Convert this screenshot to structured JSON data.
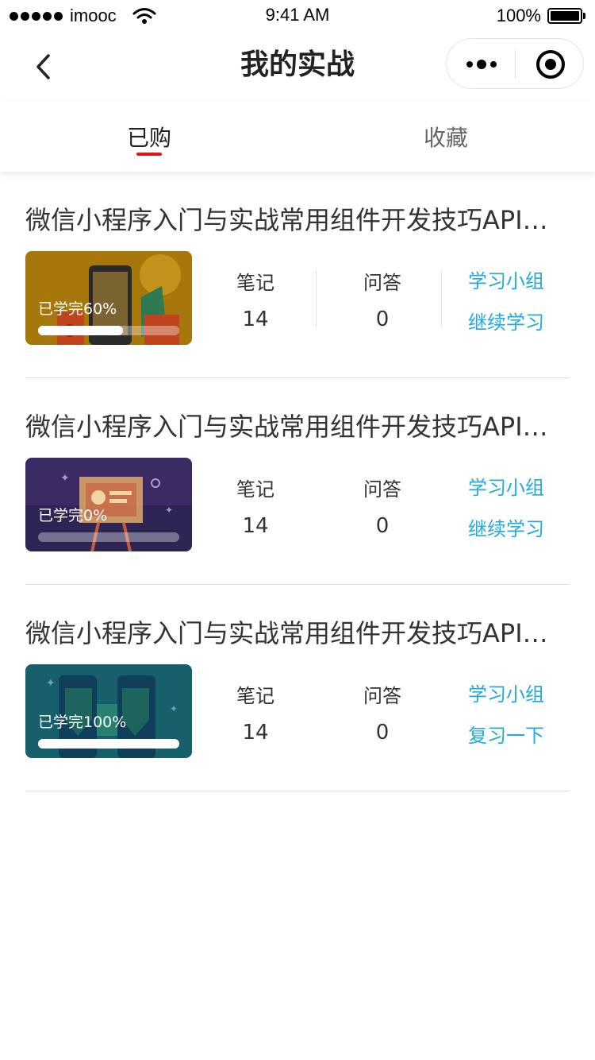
{
  "status_bar": {
    "carrier": "imooc",
    "time": "9:41 AM",
    "battery": "100%"
  },
  "nav": {
    "title": "我的实战"
  },
  "tabs": [
    {
      "label": "已购",
      "active": true
    },
    {
      "label": "收藏",
      "active": false
    }
  ],
  "courses": [
    {
      "title": "微信小程序入门与实战常用组件开发技巧API…",
      "progress_text": "已学完60%",
      "progress": 0.6,
      "notes_label": "笔记",
      "notes_count": "14",
      "qa_label": "问答",
      "qa_count": "0",
      "group_link": "学习小组",
      "action_link": "继续学习",
      "theme_color": "#b8860b"
    },
    {
      "title": "微信小程序入门与实战常用组件开发技巧API…",
      "progress_text": "已学完0%",
      "progress": 0,
      "notes_label": "笔记",
      "notes_count": "14",
      "qa_label": "问答",
      "qa_count": "0",
      "group_link": "学习小组",
      "action_link": "继续学习",
      "theme_color": "#3a2a5e"
    },
    {
      "title": "微信小程序入门与实战常用组件开发技巧API…",
      "progress_text": "已学完100%",
      "progress": 1,
      "notes_label": "笔记",
      "notes_count": "14",
      "qa_label": "问答",
      "qa_count": "0",
      "group_link": "学习小组",
      "action_link": "复习一下",
      "theme_color": "#17606b"
    }
  ],
  "colors": {
    "accent": "#21a9e1",
    "tab_indicator": "#e4141b"
  }
}
